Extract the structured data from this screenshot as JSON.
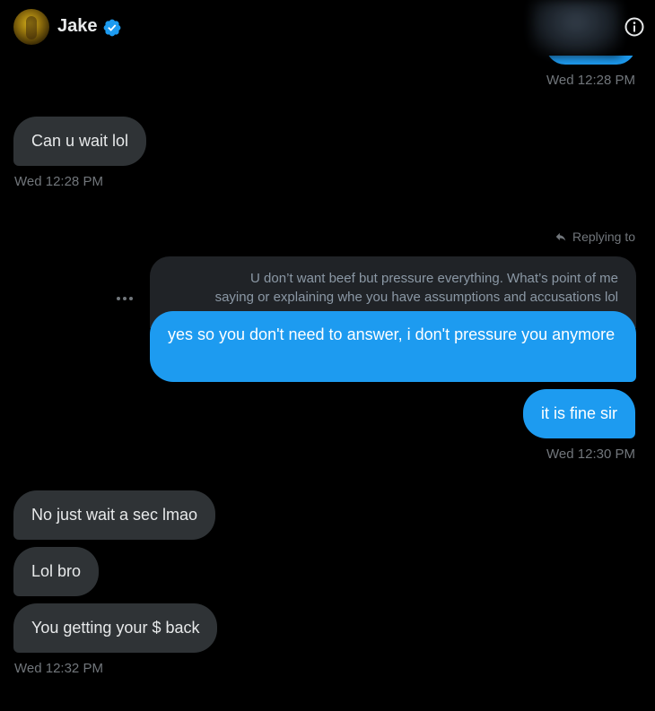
{
  "header": {
    "name": "Jake",
    "avatar_icon": "avatar",
    "verified_icon": "verified-badge-icon",
    "info_icon": "info-icon"
  },
  "messages": {
    "ts_top": "Wed 12:28 PM",
    "in_1": "Can u wait lol",
    "ts_in_1": "Wed 12:28 PM",
    "replying_to": "Replying to",
    "quote_line_1": "U don’t want beef but pressure everything. What’s point of me",
    "quote_line_2": "saying or explaining whe you have assumptions and accusations lol",
    "out_reply": "yes so you don't need to answer, i don't pressure you anymore",
    "out_2": "it is fine sir",
    "ts_out": "Wed 12:30 PM",
    "in_2": "No just wait a sec lmao",
    "in_3": "Lol bro",
    "in_4": "You getting your $ back",
    "ts_in_last": "Wed 12:32 PM"
  },
  "colors": {
    "background": "#000000",
    "outgoing_bubble": "#1d9bf0",
    "incoming_bubble": "#2f3336",
    "quote_bg": "#202327",
    "timestamp": "#71767b"
  }
}
